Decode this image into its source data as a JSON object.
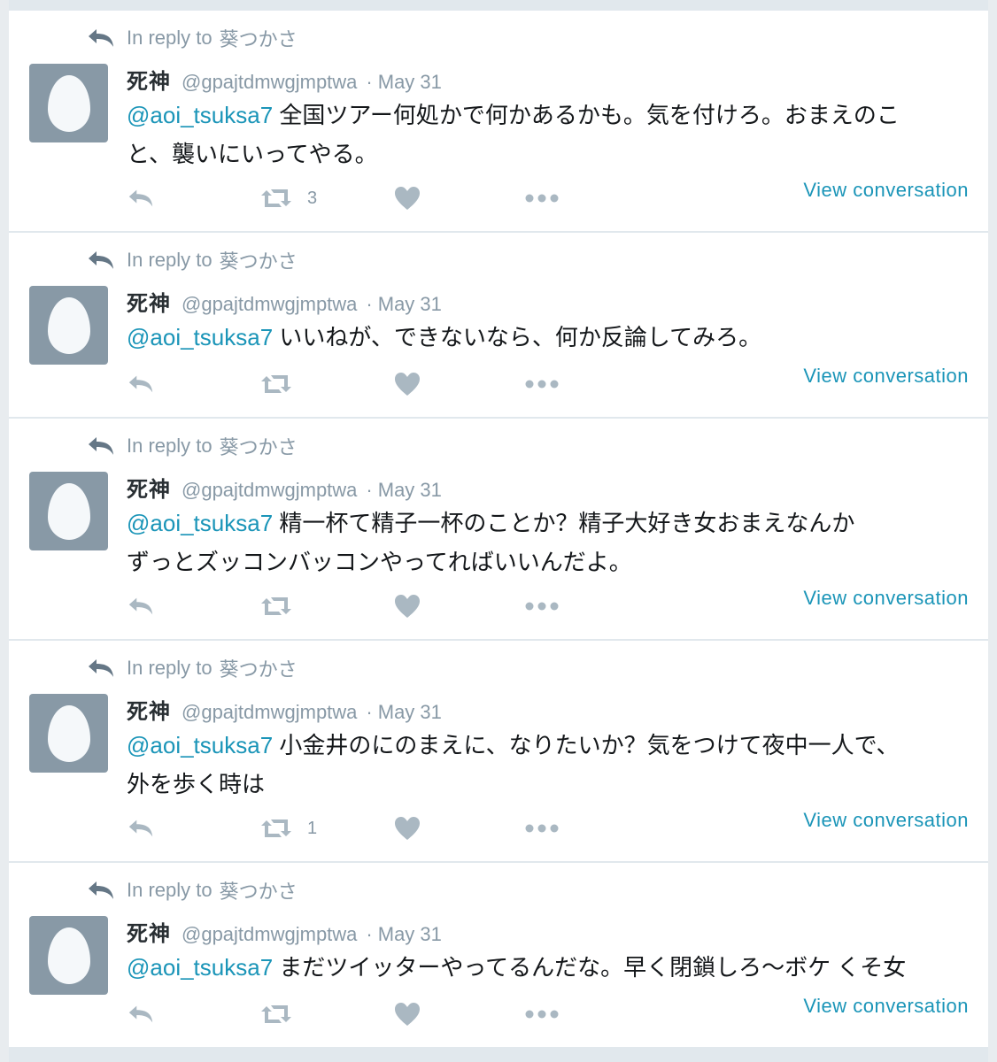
{
  "colors": {
    "background": "#e1e8ed",
    "card": "#ffffff",
    "muted_text": "#8899a6",
    "link": "#1b95b8",
    "avatar_bg": "#8899a6"
  },
  "icons": {
    "reply": "reply-arrow-icon",
    "retweet": "retweet-icon",
    "like": "heart-icon",
    "more": "ellipsis-icon",
    "avatar": "default-egg-avatar"
  },
  "tweets": [
    {
      "reply_prefix": "In reply to",
      "reply_to": "葵つかさ",
      "display_name": "死神",
      "screen_name": "@gpajtdmwgjmptwa",
      "separator": "·",
      "time": "May 31",
      "mention": "@aoi_tsuksa7",
      "text_line1": " 全国ツアー何処かで何かあるかも。気を付けろ。おまえのこ",
      "text_line2": "と、襲いにいってやる。",
      "retweet_count": "3",
      "view_conversation": "View conversation"
    },
    {
      "reply_prefix": "In reply to",
      "reply_to": "葵つかさ",
      "display_name": "死神",
      "screen_name": "@gpajtdmwgjmptwa",
      "separator": "·",
      "time": "May 31",
      "mention": "@aoi_tsuksa7",
      "text_line1": " いいねが、できないなら、何か反論してみろ。",
      "text_line2": "",
      "retweet_count": "",
      "view_conversation": "View conversation"
    },
    {
      "reply_prefix": "In reply to",
      "reply_to": "葵つかさ",
      "display_name": "死神",
      "screen_name": "@gpajtdmwgjmptwa",
      "separator": "·",
      "time": "May 31",
      "mention": "@aoi_tsuksa7",
      "text_line1": " 精一杯て精子一杯のことか？精子大好き女おまえなんか",
      "text_line2": "ずっとズッコンバッコンやってればいいんだよ。",
      "retweet_count": "",
      "view_conversation": "View conversation"
    },
    {
      "reply_prefix": "In reply to",
      "reply_to": "葵つかさ",
      "display_name": "死神",
      "screen_name": "@gpajtdmwgjmptwa",
      "separator": "·",
      "time": "May 31",
      "mention": "@aoi_tsuksa7",
      "text_line1": " 小金井のにのまえに、なりたいか？気をつけて夜中一人で、",
      "text_line2": "外を歩く時は",
      "retweet_count": "1",
      "view_conversation": "View conversation"
    },
    {
      "reply_prefix": "In reply to",
      "reply_to": "葵つかさ",
      "display_name": "死神",
      "screen_name": "@gpajtdmwgjmptwa",
      "separator": "·",
      "time": "May 31",
      "mention": "@aoi_tsuksa7",
      "text_line1": " まだツイッターやってるんだな。早く閉鎖しろ〜ボケ くそ女",
      "text_line2": "",
      "retweet_count": "",
      "view_conversation": "View conversation"
    }
  ]
}
